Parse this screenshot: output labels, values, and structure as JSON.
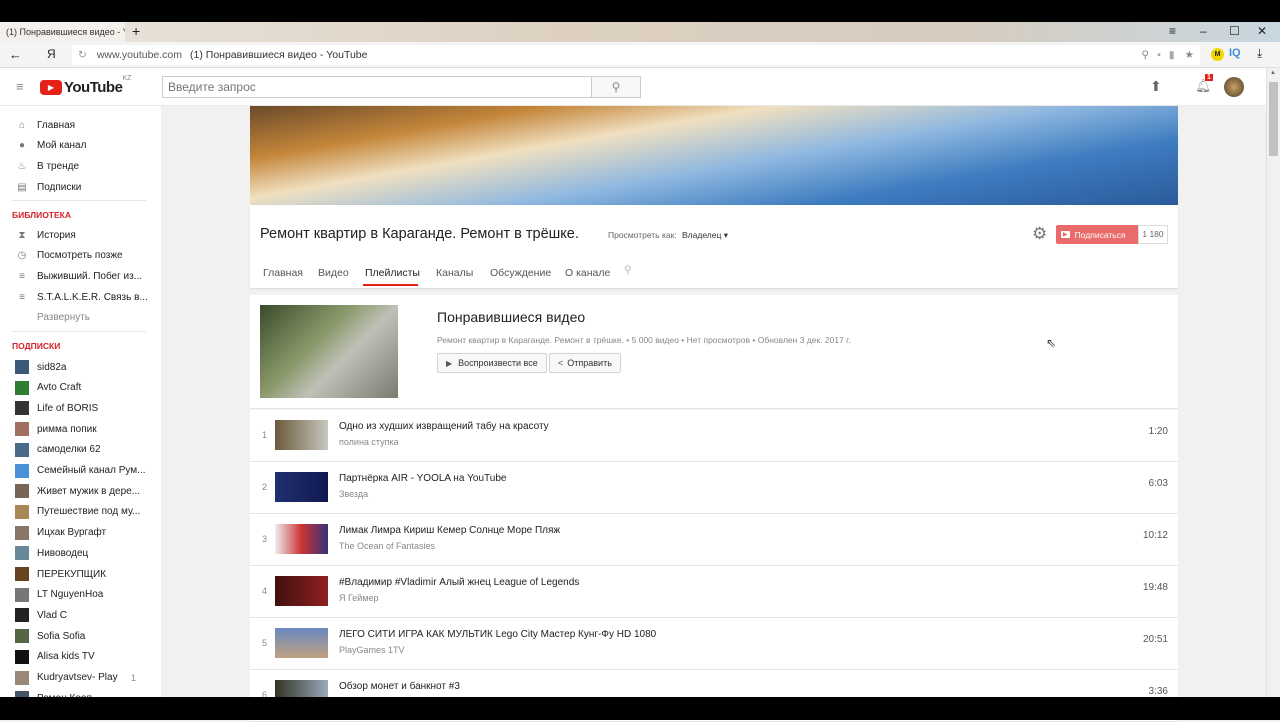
{
  "browser": {
    "tab_title": "(1) Понравившиеся видео - YouTube",
    "new_tab": "+",
    "url_domain": "www.youtube.com",
    "url_title": "(1) Понравившиеся видео - YouTube",
    "yandex": "Я",
    "ext_m": "M",
    "ext_iq": "IQ"
  },
  "header": {
    "logo": "YouTube",
    "region": "KZ",
    "search_placeholder": "Введите запрос",
    "notifications": "1"
  },
  "sidebar": {
    "main": [
      {
        "label": "Главная",
        "icon": "home-icon"
      },
      {
        "label": "Мой канал",
        "icon": "account-icon"
      },
      {
        "label": "В тренде",
        "icon": "flame-icon"
      },
      {
        "label": "Подписки",
        "icon": "subscriptions-icon"
      }
    ],
    "library_heading": "БИБЛИОТЕКА",
    "library": [
      {
        "label": "История",
        "icon": "hourglass-icon"
      },
      {
        "label": "Посмотреть позже",
        "icon": "clock-icon"
      },
      {
        "label": "Выживший. Побег из...",
        "icon": "playlist-icon"
      },
      {
        "label": "S.T.A.L.K.E.R. Связь в...",
        "icon": "playlist-icon"
      }
    ],
    "expand": "Развернуть",
    "subs_heading": "ПОДПИСКИ",
    "subs": [
      {
        "label": "sid82a",
        "badge": ""
      },
      {
        "label": "Avto Craft",
        "badge": ""
      },
      {
        "label": "Life of BORIS",
        "badge": ""
      },
      {
        "label": "римма попик",
        "badge": ""
      },
      {
        "label": "самоделки 62",
        "badge": ""
      },
      {
        "label": "Семейный канал Рум...",
        "badge": ""
      },
      {
        "label": "Живет мужик в дере...",
        "badge": ""
      },
      {
        "label": "Путешествие под му...",
        "badge": ""
      },
      {
        "label": "Ицхак Вургафт",
        "badge": ""
      },
      {
        "label": "Нивоводец",
        "badge": ""
      },
      {
        "label": "ПЕРЕКУПЩИК",
        "badge": ""
      },
      {
        "label": "LT NguyenHoa",
        "badge": ""
      },
      {
        "label": "Vlad C",
        "badge": ""
      },
      {
        "label": "Sofia Sofia",
        "badge": ""
      },
      {
        "label": "Alisa kids TV",
        "badge": ""
      },
      {
        "label": "Kudryavtsev- Play",
        "badge": "1"
      },
      {
        "label": "Роман Кооп...",
        "badge": ""
      }
    ]
  },
  "channel": {
    "name": "Ремонт квартир в Караганде. Ремонт в трёшке.",
    "view_as_label": "Просмотреть как:",
    "view_as_value": "Владелец",
    "subscribe": "Подписаться",
    "subscribers": "1 180",
    "tabs": [
      "Главная",
      "Видео",
      "Плейлисты",
      "Каналы",
      "Обсуждение",
      "О канале"
    ],
    "active_tab": 2
  },
  "playlist": {
    "title": "Понравившиеся видео",
    "meta": "Ремонт квартир в Караганде. Ремонт в трёшке. • 5 000 видео • Нет просмотров • Обновлен 3 дек. 2017 г.",
    "play_all": "Воспроизвести все",
    "share": "Отправить"
  },
  "videos": [
    {
      "n": "1",
      "title": "Одно из худших извращений табу на красоту",
      "channel": "полина ступка",
      "duration": "1:20"
    },
    {
      "n": "2",
      "title": "Партнёрка AIR - YOOLA на YouTube",
      "channel": "Звезда",
      "duration": "6:03"
    },
    {
      "n": "3",
      "title": "Лимак Лимра Кириш Кемер Солнце Море Пляж",
      "channel": "The Ocean of Fantasies",
      "duration": "10:12"
    },
    {
      "n": "4",
      "title": "#Владимир #Vladimir Алый жнец League of Legends",
      "channel": "Я Геймер",
      "duration": "19:48"
    },
    {
      "n": "5",
      "title": "ЛЕГО СИТИ ИГРА КАК МУЛЬТИК Lego City Мастер Кунг-Фу HD 1080",
      "channel": "PlayGames 1TV",
      "duration": "20:51"
    },
    {
      "n": "6",
      "title": "Обзор монет и банкнот #3",
      "channel": "",
      "duration": "3:36"
    }
  ],
  "colors": {
    "accent": "#e62117",
    "subscribe": "#e96b6b"
  }
}
